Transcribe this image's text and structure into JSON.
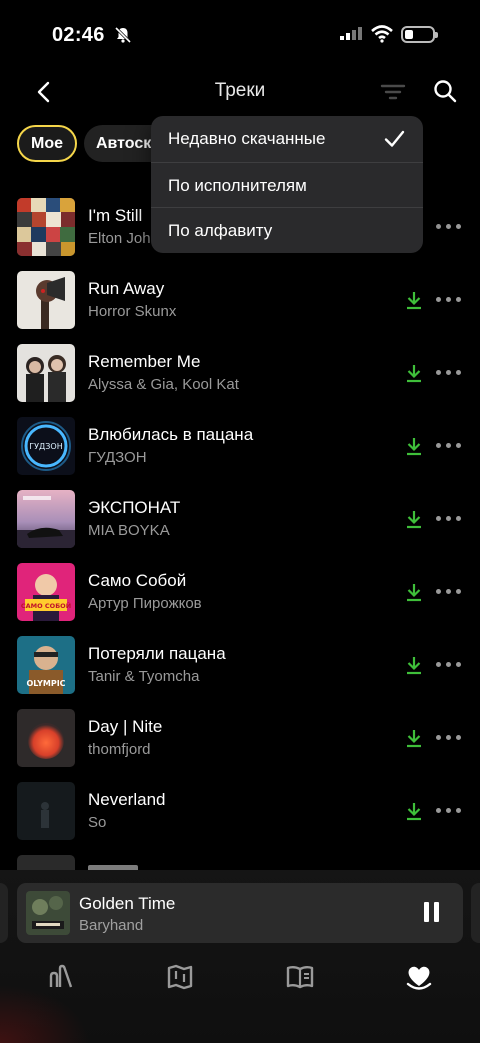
{
  "status_bar": {
    "time": "02:46"
  },
  "header": {
    "title": "Треки"
  },
  "filters": {
    "mine": "Мое",
    "auto": "Автоск"
  },
  "sort_menu": {
    "items": [
      "Недавно скачанные",
      "По исполнителям",
      "По алфавиту"
    ],
    "selected_index": 0
  },
  "tracks": [
    {
      "title": "I'm Still",
      "artist": "Elton Joh",
      "downloaded": true
    },
    {
      "title": "Run Away",
      "artist": "Horror Skunx",
      "downloaded": true
    },
    {
      "title": "Remember Me",
      "artist": "Alyssa & Gia, Kool Kat",
      "downloaded": true
    },
    {
      "title": "Влюбилась в пацана",
      "artist": "ГУДЗОН",
      "downloaded": true
    },
    {
      "title": "ЭКСПОНАТ",
      "artist": "MIA BOYKA",
      "downloaded": true
    },
    {
      "title": "Само Собой",
      "artist": "Артур Пирожков",
      "downloaded": true
    },
    {
      "title": "Потеряли пацана",
      "artist": "Tanir & Tyomcha",
      "downloaded": true
    },
    {
      "title": "Day | Nite",
      "artist": "thomfjord",
      "downloaded": true
    },
    {
      "title": "Neverland",
      "artist": "So",
      "downloaded": true
    }
  ],
  "cover_text": {
    "gudzon": "ГУДЗОН",
    "samo": "САМО СОБОЙ",
    "olympic": "OLYMPIC"
  },
  "now_playing": {
    "title": "Golden Time",
    "artist": "Baryhand"
  },
  "colors": {
    "accent": "#f5d64a",
    "download": "#3fbf3a",
    "muted": "#9a9a9a"
  },
  "icons": {
    "nav": [
      "home-icon",
      "map-icon",
      "book-icon",
      "heart-icon"
    ]
  }
}
